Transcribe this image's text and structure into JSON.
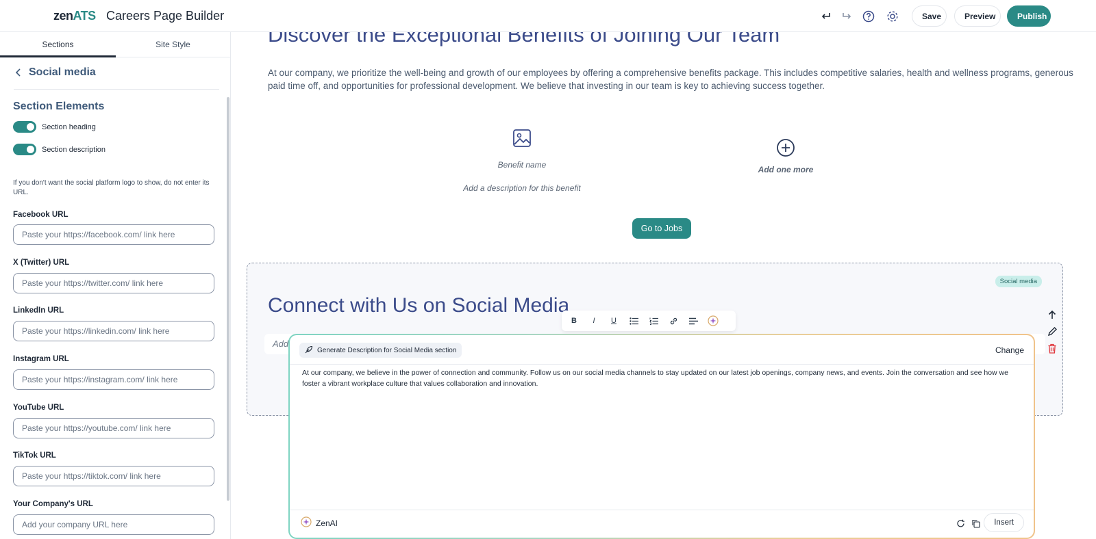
{
  "header": {
    "logo_main": "zen",
    "logo_accent": "ATS",
    "title": "Careers Page Builder",
    "save_label": "Save",
    "preview_label": "Preview",
    "publish_label": "Publish",
    "accent_color": "#2a8a86"
  },
  "sidebar": {
    "tabs": [
      {
        "label": "Sections",
        "active": true
      },
      {
        "label": "Site Style",
        "active": false
      }
    ],
    "back_label": "Social media",
    "section_elements_title": "Section Elements",
    "toggles": [
      {
        "label": "Section heading",
        "on": true
      },
      {
        "label": "Section description",
        "on": true
      }
    ],
    "hint": "If you don't want the social platform logo to show, do not enter its URL.",
    "fields": [
      {
        "label": "Facebook URL",
        "placeholder": "Paste your https://facebook.com/ link here"
      },
      {
        "label": "X (Twitter) URL",
        "placeholder": "Paste your https://twitter.com/ link here"
      },
      {
        "label": "LinkedIn URL",
        "placeholder": "Paste your https://linkedin.com/ link here"
      },
      {
        "label": "Instagram URL",
        "placeholder": "Paste your https://instagram.com/ link here"
      },
      {
        "label": "YouTube URL",
        "placeholder": "Paste your https://youtube.com/ link here"
      },
      {
        "label": "TikTok URL",
        "placeholder": "Paste your https://tiktok.com/ link here"
      },
      {
        "label": "Your Company's URL",
        "placeholder": "Add your company URL here"
      }
    ]
  },
  "main": {
    "benefits_heading": "Discover the Exceptional Benefits of Joining Our Team",
    "benefits_paragraph": "At our company, we prioritize the well-being and growth of our employees by offering a comprehensive benefits package. This includes competitive salaries, health and wellness programs, generous paid time off, and opportunities for professional development. We believe that investing in our team is key to achieving success together.",
    "benefit_name": "Benefit name",
    "benefit_description": "Add a description for this benefit",
    "add_more_label": "Add one more",
    "jobs_button": "Go to Jobs",
    "social": {
      "badge": "Social media",
      "heading": "Connect with Us on Social Media",
      "description_placeholder": "Add"
    }
  },
  "ai_dialog": {
    "chip_label": "Generate Description for Social Media section",
    "change_label": "Change",
    "generated_text": "At our company, we believe in the power of connection and community. Follow us on our social media channels to stay updated on our latest job openings, company news, and events. Join the conversation and see how we foster a vibrant workplace culture that values collaboration and innovation.",
    "brand": "ZenAI",
    "insert_label": "Insert"
  }
}
